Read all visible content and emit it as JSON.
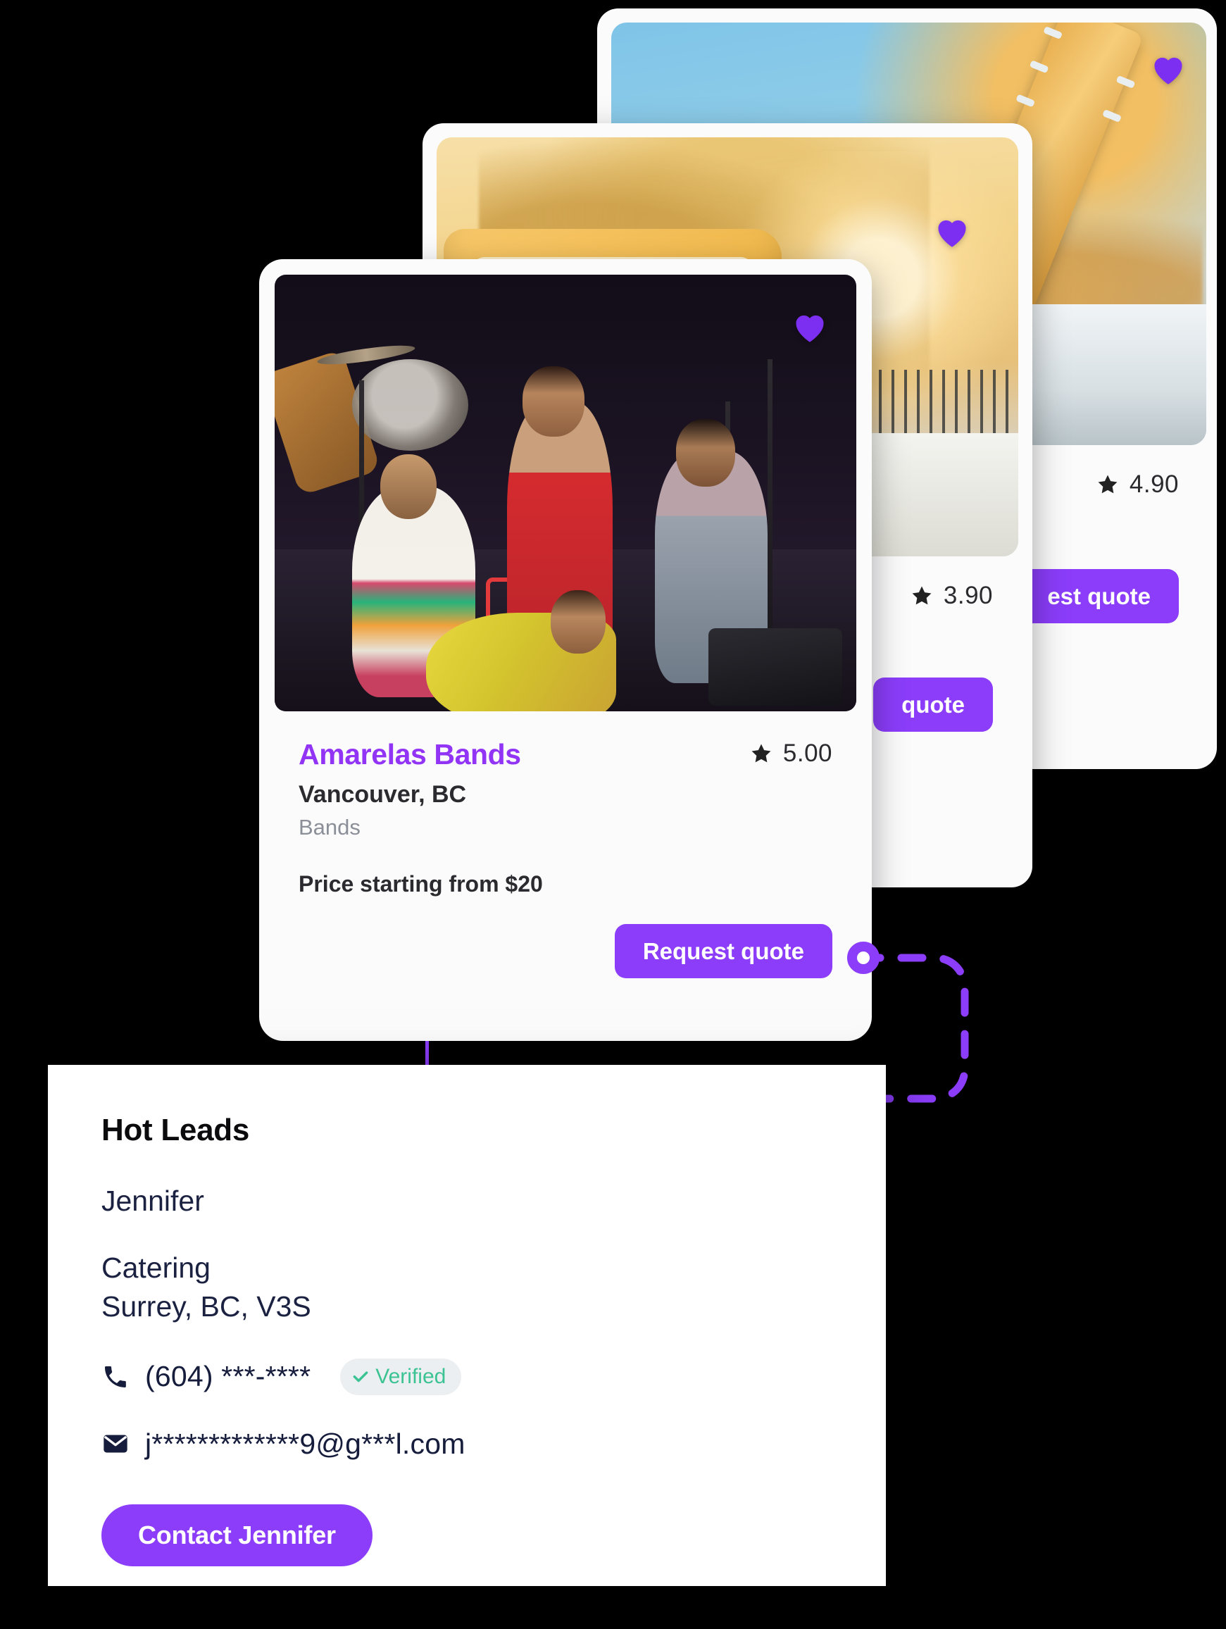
{
  "theme": {
    "accent_purple": "#8b3dfa",
    "link_purple": "#9234f6",
    "verified_green": "#3cc393",
    "navy": "#161d3c",
    "background": "#000000",
    "card_background": "#fbfbfc"
  },
  "cards": {
    "back": {
      "rating": "4.90",
      "star_icon": "star-icon",
      "favorite_icon": "heart-icon",
      "quote_button_label": "est quote"
    },
    "middle": {
      "rating": "3.90",
      "star_icon": "star-icon",
      "favorite_icon": "heart-icon",
      "quote_button_label": "quote"
    },
    "front": {
      "business_name": "Amarelas Bands",
      "location": "Vancouver, BC",
      "category": "Bands",
      "price": "Price starting from $20",
      "rating": "5.00",
      "star_icon": "star-icon",
      "favorite_icon": "heart-icon",
      "quote_button_label": "Request quote"
    }
  },
  "leads": {
    "title": "Hot Leads",
    "name": "Jennifer",
    "category": "Catering",
    "location": "Surrey, BC, V3S",
    "phone": "(604) ***-****",
    "phone_icon": "phone-icon",
    "verified_badge": "Verified",
    "verified_icon": "check-icon",
    "email": "j*************9@g***l.com",
    "email_icon": "envelope-icon",
    "contact_button_label": "Contact Jennifer"
  }
}
